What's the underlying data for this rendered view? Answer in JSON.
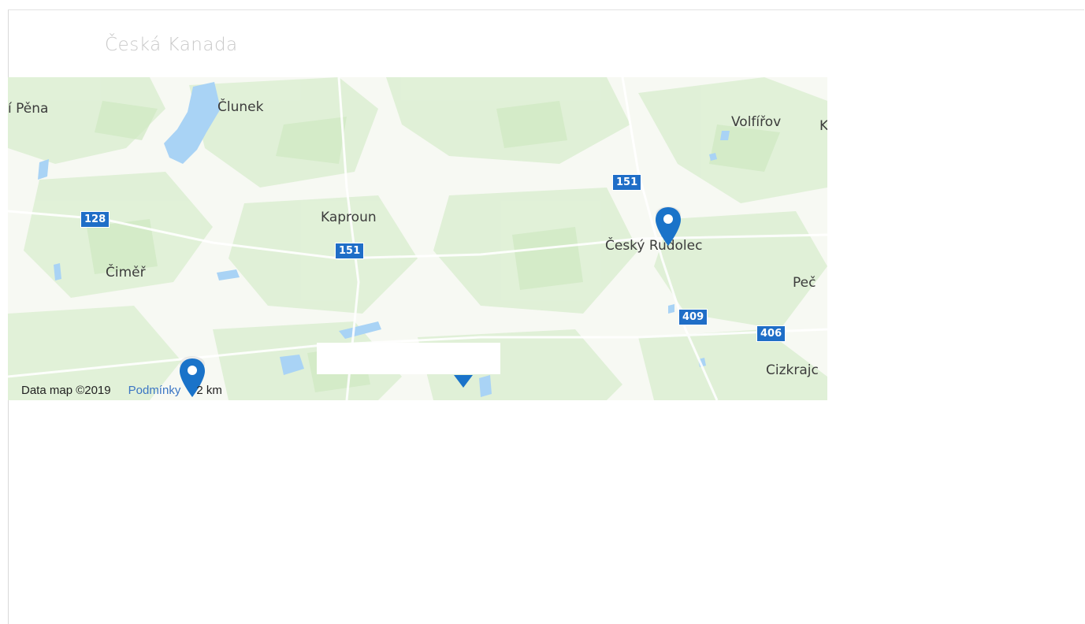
{
  "title": "Česká Kanada",
  "map": {
    "places": [
      {
        "name": "í Pěna"
      },
      {
        "name": "Člunek"
      },
      {
        "name": "Volfířov"
      },
      {
        "name": "K"
      },
      {
        "name": "Kaproun"
      },
      {
        "name": "Český Rudolec"
      },
      {
        "name": "Čiměř"
      },
      {
        "name": "Peč"
      },
      {
        "name": "Cizkrajc"
      }
    ],
    "roads": [
      "128",
      "151",
      "151",
      "409",
      "406"
    ],
    "pin_icon": "map-pin-icon",
    "pin_color": "#1a73c9",
    "water_color": "#a9d3f5",
    "forest_color": "#dff0d6"
  },
  "attribution": {
    "copyright": "Data map ©2019",
    "terms": "Podmínky",
    "scale": "2 km"
  }
}
